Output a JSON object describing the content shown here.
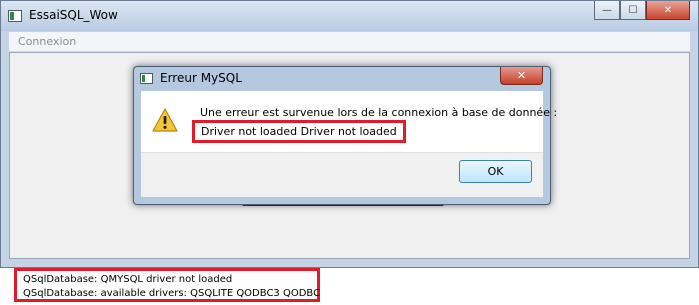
{
  "window": {
    "title": "EssaiSQL_Wow",
    "controls": {
      "minimize": "—",
      "maximize": "☐",
      "close": "✕"
    }
  },
  "menubar": {
    "items": [
      "Connexion"
    ]
  },
  "dialog": {
    "title": "Erreur MySQL",
    "close": "✕",
    "message_line1": "Une erreur est survenue lors de la connexion à base de donnée :",
    "message_line2": "Driver not loaded Driver not loaded",
    "ok_label": "OK",
    "icon": "warning-icon"
  },
  "console": {
    "lines": [
      "QSqlDatabase: QMYSQL driver not loaded",
      "QSqlDatabase: available drivers: QSQLITE QODBC3 QODBC"
    ]
  },
  "colors": {
    "highlight": "#e01c2a",
    "warning": "#f0c020"
  }
}
